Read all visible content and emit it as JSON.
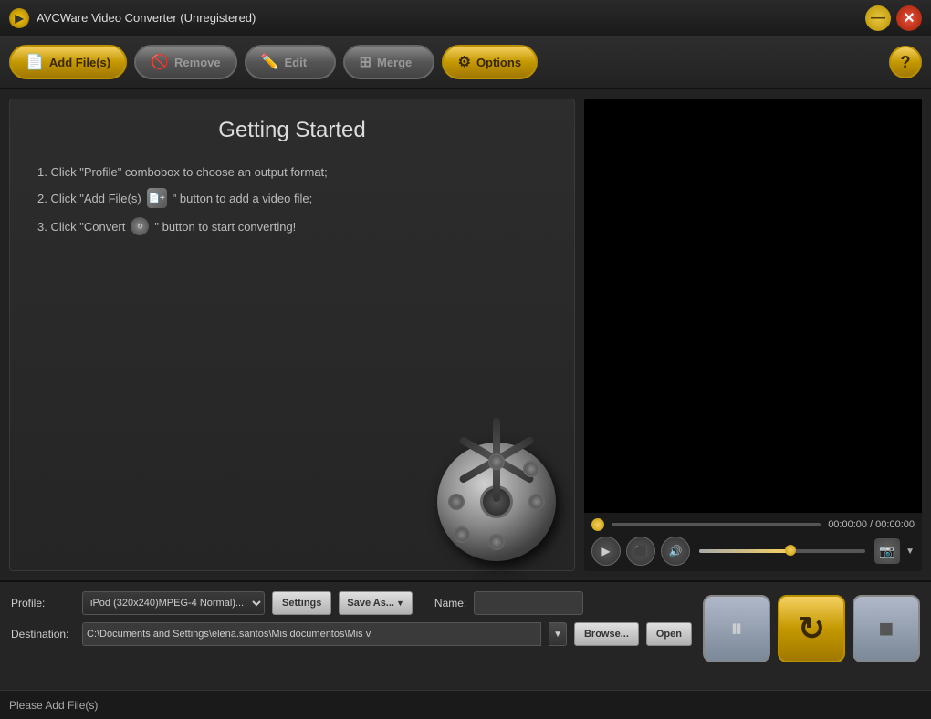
{
  "titlebar": {
    "title": "AVCWare Video Converter (Unregistered)",
    "icon_label": "A"
  },
  "toolbar": {
    "add_files_label": "Add File(s)",
    "remove_label": "Remove",
    "edit_label": "Edit",
    "merge_label": "Merge",
    "options_label": "Options",
    "help_label": "?"
  },
  "getting_started": {
    "title": "Getting Started",
    "step1": "1. Click \"Profile\" combobox to choose an output format;",
    "step2_prefix": "2. Click \"Add File(s) ",
    "step2_suffix": "\" button to add a video file;",
    "step3_prefix": "3. Click \"Convert ",
    "step3_suffix": "\" button to start converting!"
  },
  "video_controls": {
    "time_display": "00:00:00 / 00:00:00",
    "progress_percent": 0,
    "volume_percent": 55
  },
  "profile": {
    "label": "Profile:",
    "value": "iPod (320x240)MPEG-4 Normal)...",
    "settings_label": "Settings",
    "saveas_label": "Save As...",
    "name_label": "Name:",
    "name_value": ""
  },
  "destination": {
    "label": "Destination:",
    "path": "C:\\Documents and Settings\\elena.santos\\Mis documentos\\Mis v",
    "browse_label": "Browse...",
    "open_label": "Open"
  },
  "action_buttons": {
    "pause_icon": "⏸",
    "convert_icon": "↻",
    "stop_icon": "■"
  },
  "status": {
    "text": "Please Add File(s)"
  }
}
